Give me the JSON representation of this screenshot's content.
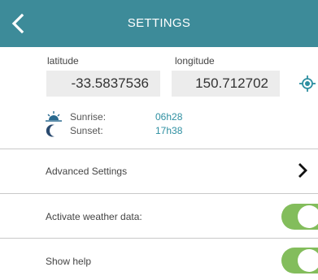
{
  "header": {
    "title": "SETTINGS",
    "back_icon": "chevron-left-icon",
    "color": "#3d8b99"
  },
  "location": {
    "latitude_label": "latitude",
    "latitude_value": "-33.5837536",
    "longitude_label": "longitude",
    "longitude_value": "150.712702",
    "locate_icon": "gps-locate-icon"
  },
  "sun": {
    "sunrise_label": "Sunrise:",
    "sunrise_value": "06h28",
    "sunrise_icon": "sunrise-icon",
    "sunset_label": "Sunset:",
    "sunset_value": "17h38",
    "sunset_icon": "moon-icon",
    "value_color": "#2e8fa1"
  },
  "rows": {
    "advanced_label": "Advanced Settings",
    "weather_label": "Activate weather data:",
    "weather_on": true,
    "help_label": "Show help",
    "help_on": true,
    "toggle_color": "#83bd5c"
  }
}
